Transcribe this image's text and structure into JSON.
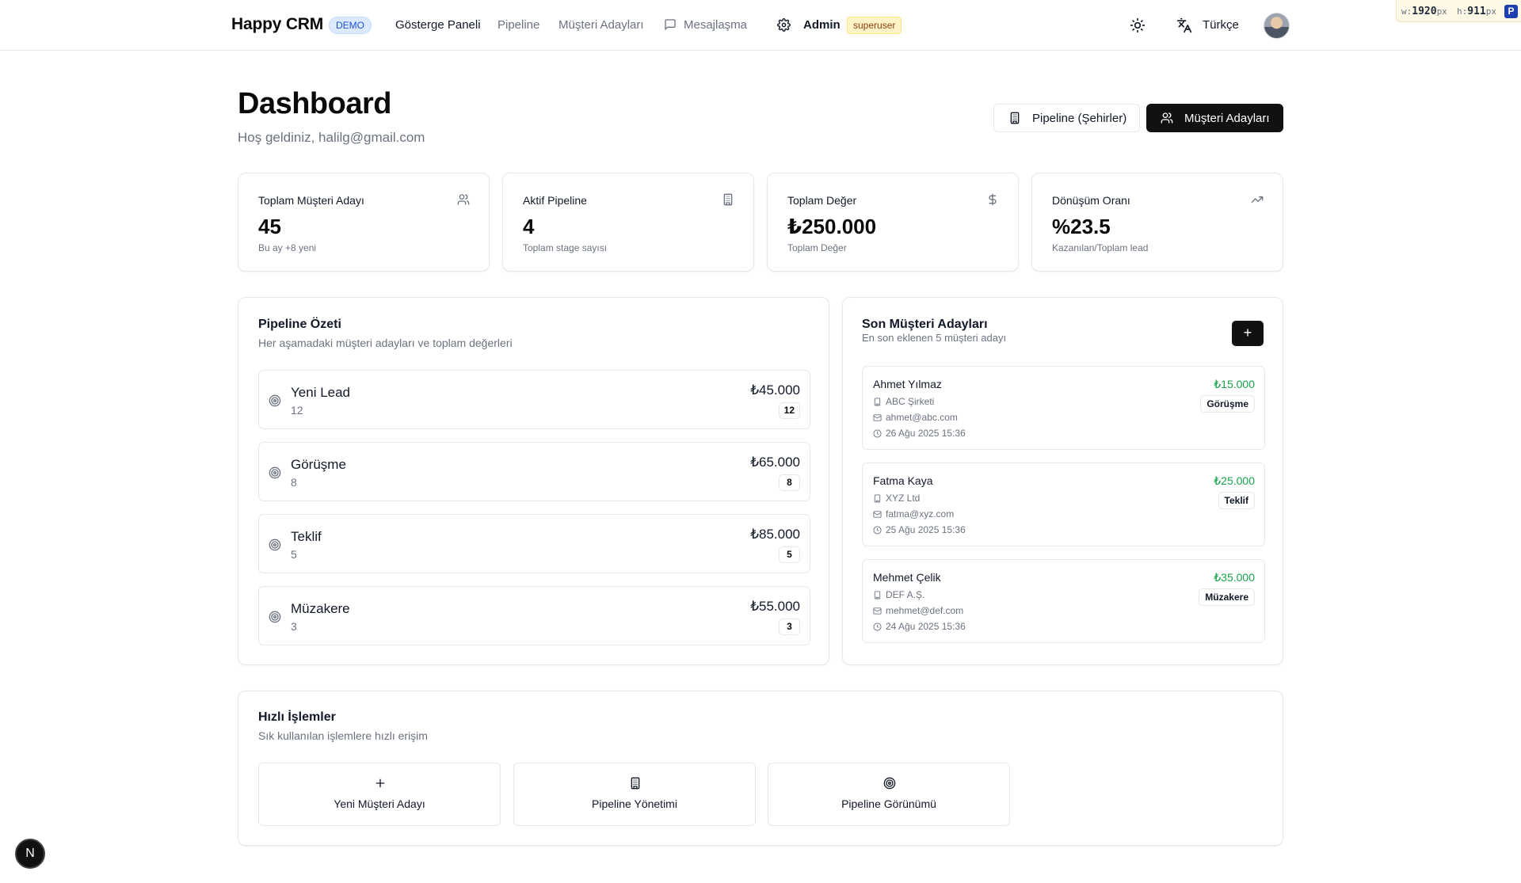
{
  "nav": {
    "brand": "Happy CRM",
    "demo_badge": "DEMO",
    "links": [
      "Gösterge Paneli",
      "Pipeline",
      "Müşteri Adayları",
      "Mesajlaşma"
    ],
    "admin_label": "Admin",
    "role_badge": "superuser",
    "language": "Türkçe"
  },
  "size_readout": {
    "w_label": "w:",
    "w_value": "1920",
    "h_label": "h:",
    "h_value": "911",
    "unit": "px",
    "logo": "P"
  },
  "header": {
    "title": "Dashboard",
    "subtitle": "Hoş geldiniz, halilg@gmail.com",
    "btn_pipeline": "Pipeline (Şehirler)",
    "btn_leads": "Müşteri Adayları"
  },
  "stats": [
    {
      "title": "Toplam Müşteri Adayı",
      "value": "45",
      "note": "Bu ay +8 yeni",
      "icon": "users-icon"
    },
    {
      "title": "Aktif Pipeline",
      "value": "4",
      "note": "Toplam stage sayısı",
      "icon": "building-icon"
    },
    {
      "title": "Toplam Değer",
      "value": "₺250.000",
      "note": "Toplam Değer",
      "icon": "dollar-icon"
    },
    {
      "title": "Dönüşüm Oranı",
      "value": "%23.5",
      "note": "Kazanılan/Toplam lead",
      "icon": "trending-up-icon"
    }
  ],
  "pipeline": {
    "title": "Pipeline Özeti",
    "description": "Her aşamadaki müşteri adayları ve toplam değerleri",
    "stages": [
      {
        "name": "Yeni Lead",
        "count": "12",
        "value": "₺45.000",
        "badge": "12"
      },
      {
        "name": "Görüşme",
        "count": "8",
        "value": "₺65.000",
        "badge": "8"
      },
      {
        "name": "Teklif",
        "count": "5",
        "value": "₺85.000",
        "badge": "5"
      },
      {
        "name": "Müzakere",
        "count": "3",
        "value": "₺55.000",
        "badge": "3"
      }
    ]
  },
  "recent": {
    "title": "Son Müşteri Adayları",
    "description": "En son eklenen 5 müşteri adayı",
    "add_label": "+",
    "leads": [
      {
        "name": "Ahmet Yılmaz",
        "company": "ABC Şirketi",
        "email": "ahmet@abc.com",
        "date": "26 Ağu 2025 15:36",
        "value": "₺15.000",
        "stage": "Görüşme"
      },
      {
        "name": "Fatma Kaya",
        "company": "XYZ Ltd",
        "email": "fatma@xyz.com",
        "date": "25 Ağu 2025 15:36",
        "value": "₺25.000",
        "stage": "Teklif"
      },
      {
        "name": "Mehmet Çelik",
        "company": "DEF A.Ş.",
        "email": "mehmet@def.com",
        "date": "24 Ağu 2025 15:36",
        "value": "₺35.000",
        "stage": "Müzakere"
      }
    ]
  },
  "quick": {
    "title": "Hızlı İşlemler",
    "description": "Sık kullanılan işlemlere hızlı erişim",
    "actions": [
      {
        "label": "Yeni Müşteri Adayı",
        "icon": "plus-icon"
      },
      {
        "label": "Pipeline Yönetimi",
        "icon": "building-icon"
      },
      {
        "label": "Pipeline Görünümü",
        "icon": "target-icon"
      }
    ]
  },
  "next_badge": "N",
  "colors": {
    "accent_dark": "#111111",
    "value_green": "#16a34a",
    "demo_blue": "#1d4ed8",
    "superuser_amber": "#92400e"
  }
}
